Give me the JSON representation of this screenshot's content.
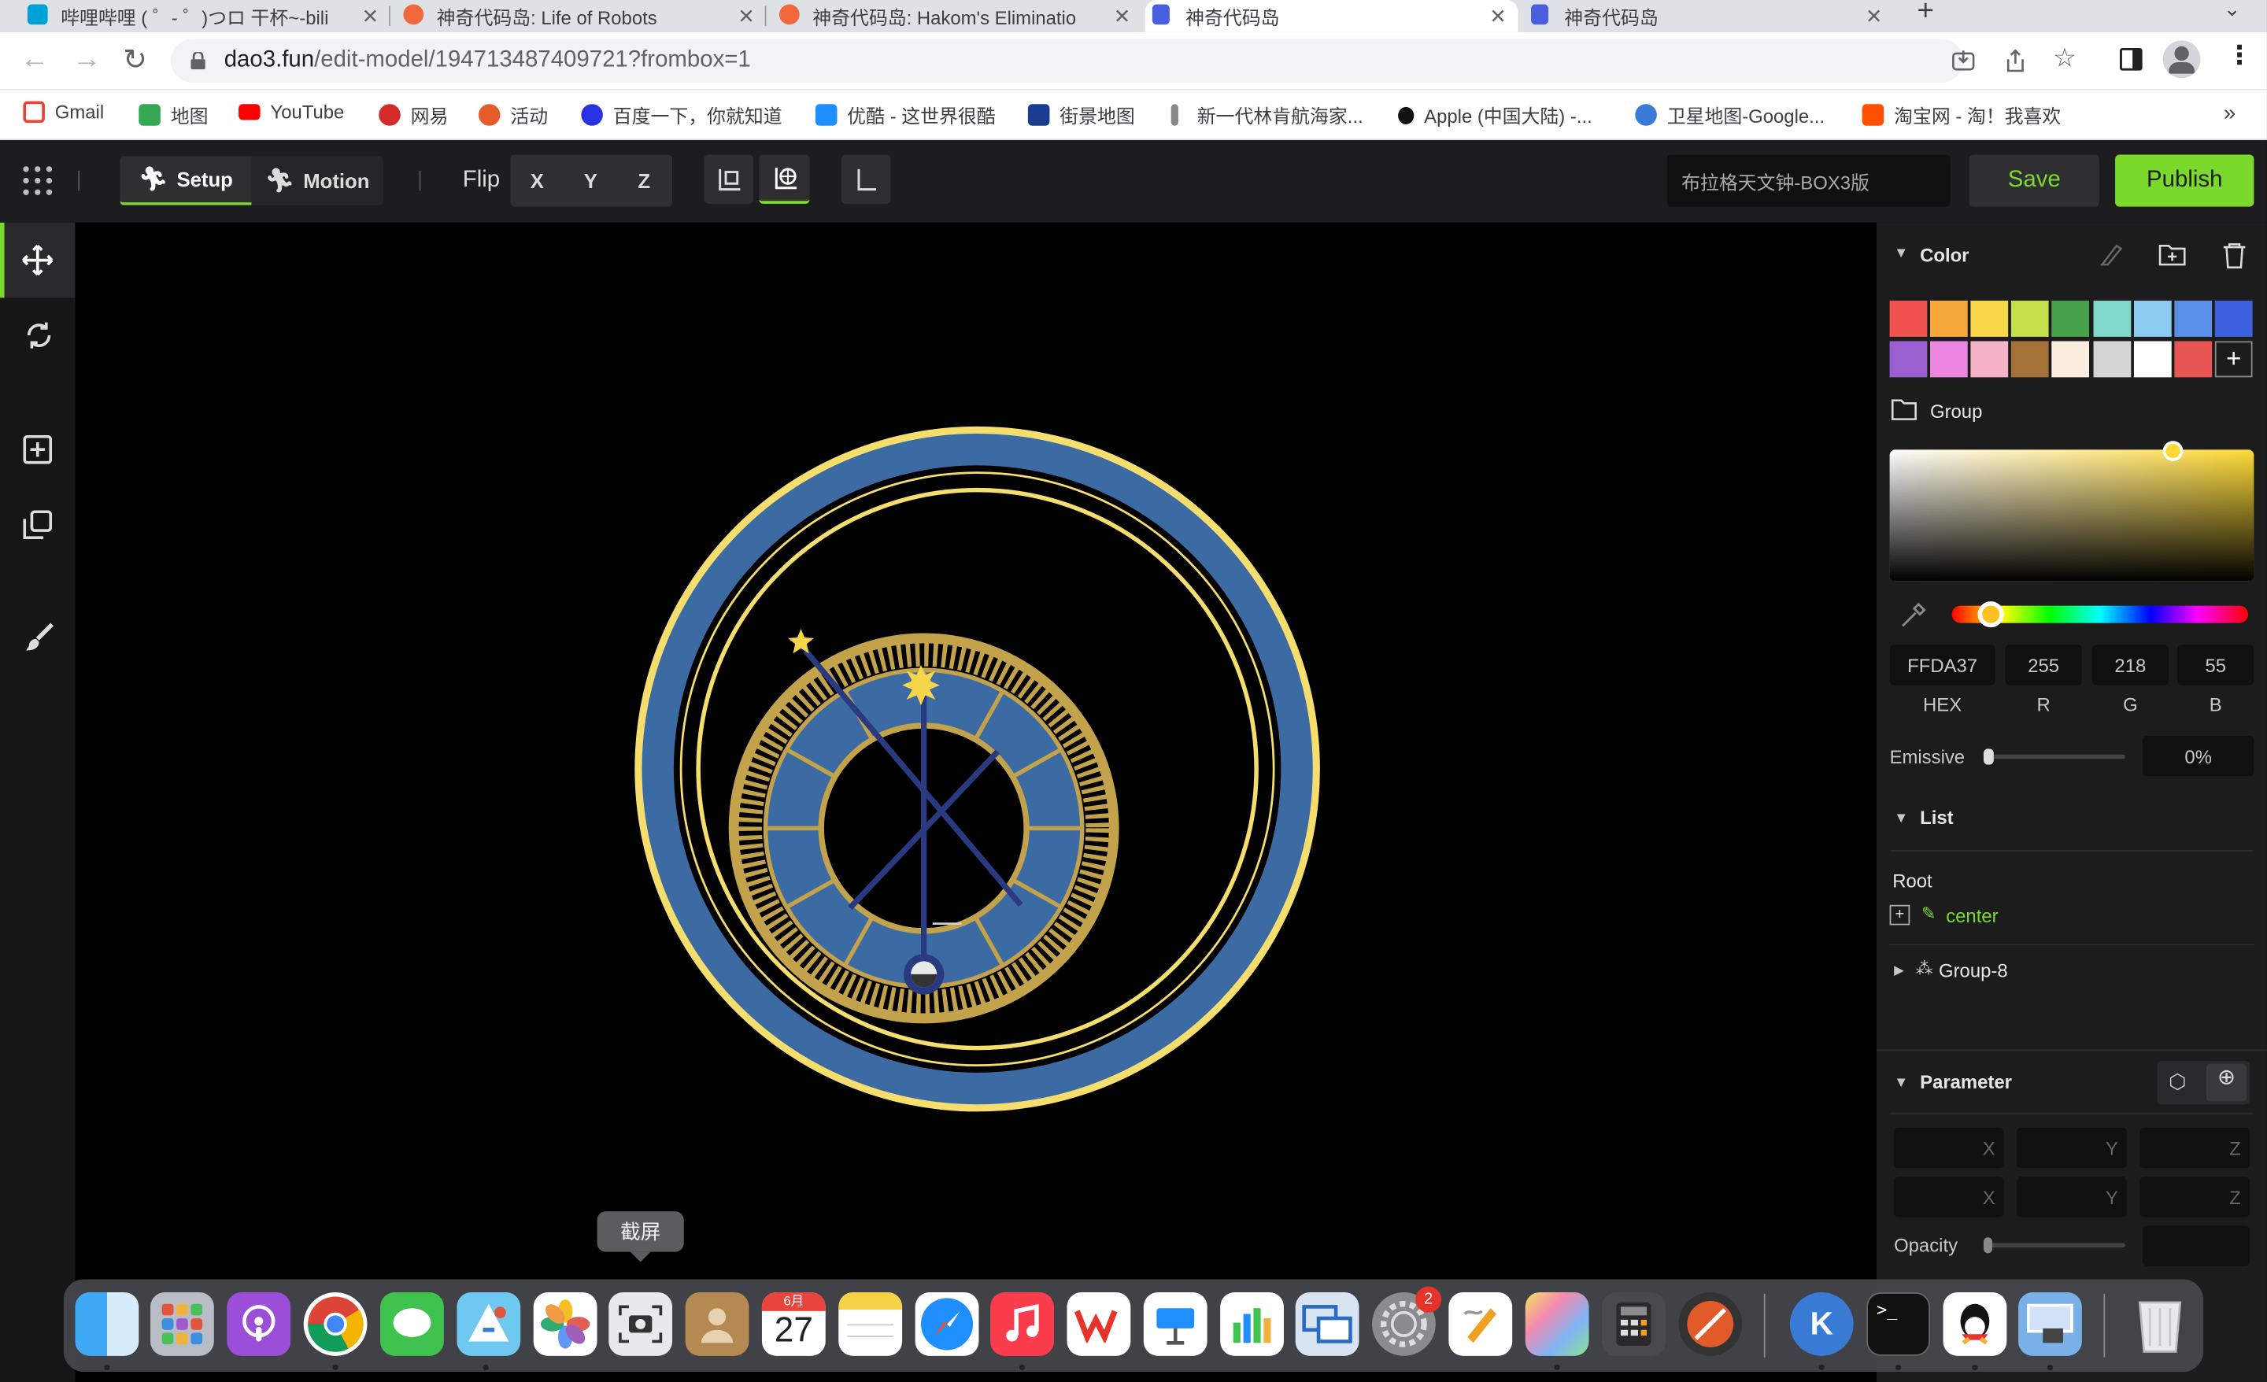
{
  "browser": {
    "tabs": [
      {
        "title": "哔哩哔哩 ( ゜- ゜)つロ 干杯~-bili",
        "favicon": "bilibili-icon",
        "color": "#00a1d6"
      },
      {
        "title": "神奇代码岛: Life of Robots",
        "favicon": "dao3-icon",
        "color": "#f1683d"
      },
      {
        "title": "神奇代码岛: Hakom's Eliminatio",
        "favicon": "dao3-icon",
        "color": "#f1683d"
      },
      {
        "title": "神奇代码岛",
        "favicon": "dao3-doc-icon",
        "color": "#4a5ee0"
      },
      {
        "title": "神奇代码岛",
        "favicon": "dao3-doc-icon",
        "color": "#4a5ee0"
      }
    ],
    "url_host": "dao3.fun",
    "url_path": "/edit-model/194713487409721?frombox=1",
    "bookmarks": [
      {
        "label": "Gmail",
        "icon": "gmail-icon",
        "color": "#ea4335"
      },
      {
        "label": "地图",
        "icon": "maps-icon",
        "color": "#34a853"
      },
      {
        "label": "YouTube",
        "icon": "youtube-icon",
        "color": "#ff0000"
      },
      {
        "label": "网易",
        "icon": "netease-icon",
        "color": "#d62b2b"
      },
      {
        "label": "活动",
        "icon": "activity-icon",
        "color": "#e65b2a"
      },
      {
        "label": "百度一下，你就知道",
        "icon": "baidu-icon",
        "color": "#2932e1"
      },
      {
        "label": "优酷 - 这世界很酷",
        "icon": "youku-icon",
        "color": "#1f8fff"
      },
      {
        "label": "街景地图",
        "icon": "streetview-icon",
        "color": "#1a3d8f"
      },
      {
        "label": "新一代林肯航海家...",
        "icon": "lincoln-icon",
        "color": "#555555"
      },
      {
        "label": "Apple (中国大陆) -...",
        "icon": "apple-icon",
        "color": "#111111"
      },
      {
        "label": "卫星地图-Google...",
        "icon": "globe-icon",
        "color": "#3a7bd5"
      },
      {
        "label": "淘宝网 - 淘！我喜欢",
        "icon": "taobao-icon",
        "color": "#ff5000"
      }
    ],
    "bookmarks_more": "»"
  },
  "editor": {
    "modes": [
      {
        "label": "Setup",
        "icon": "person-icon"
      },
      {
        "label": "Motion",
        "icon": "running-icon"
      }
    ],
    "flip_label": "Flip",
    "axes": [
      "X",
      "Y",
      "Z"
    ],
    "model_name": "布拉格天文钟-BOX3版",
    "save_label": "Save",
    "publish_label": "Publish",
    "accent": "#7ad92a"
  },
  "panel": {
    "color_title": "Color",
    "swatches": [
      "#f05350",
      "#f7a93b",
      "#f7d64a",
      "#c4e04a",
      "#45a24a",
      "#7fd8c8",
      "#8ccaf0",
      "#5b8fe6",
      "#3c62e0",
      "#9a5fd0",
      "#ec86e0",
      "#f4b3c8",
      "#a47236",
      "#fbeede",
      "#d5d5d5",
      "#ffffff",
      "#e85654"
    ],
    "add_swatch": "+",
    "group_label": "Group",
    "hex": "FFDA37",
    "r": "255",
    "g": "218",
    "b": "55",
    "hex_label": "HEX",
    "r_label": "R",
    "g_label": "G",
    "b_label": "B",
    "emissive_label": "Emissive",
    "emissive_value": "0%",
    "emissive_level": 0,
    "list_title": "List",
    "root_label": "Root",
    "center_label": "center",
    "group8_label": "Group-8",
    "parameter_title": "Parameter",
    "param_axes": [
      "X",
      "Y",
      "Z"
    ],
    "opacity_label": "Opacity",
    "selected_color": "#ffda37"
  },
  "dock": {
    "tooltip": "截屏",
    "calendar_month": "6月",
    "calendar_day": "27",
    "settings_badge": "2"
  }
}
